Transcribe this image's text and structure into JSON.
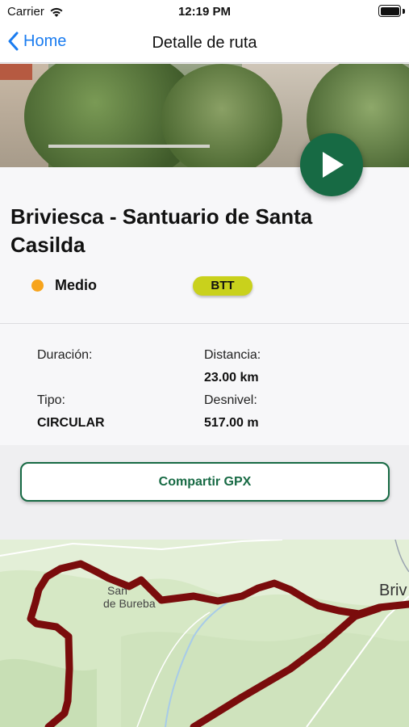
{
  "status_bar": {
    "carrier": "Carrier",
    "time": "12:19 PM",
    "wifi_icon": "wifi-icon",
    "battery_icon": "battery-icon"
  },
  "nav": {
    "back_label": "Home",
    "title": "Detalle de ruta",
    "back_icon": "chevron-left-icon"
  },
  "route": {
    "title": "Briviesca -  Santuario de Santa Casilda",
    "difficulty": "Medio",
    "difficulty_color": "#f7a41c",
    "type": "BTT",
    "type_color": "#c9d11c"
  },
  "details": {
    "duration_label": "Duración:",
    "duration_value": "",
    "distance_label": "Distancia:",
    "distance_value": "23.00 km",
    "type_label": "Tipo:",
    "type_value": "CIRCULAR",
    "elevation_label": "Desnivel:",
    "elevation_value": "517.00 m"
  },
  "actions": {
    "share_label": "Compartir GPX",
    "play_icon": "play-icon"
  },
  "map": {
    "labels": [
      "San",
      "de Bureba",
      "Briv"
    ],
    "route_color": "#7a0c0c",
    "accent": "#176a44"
  }
}
